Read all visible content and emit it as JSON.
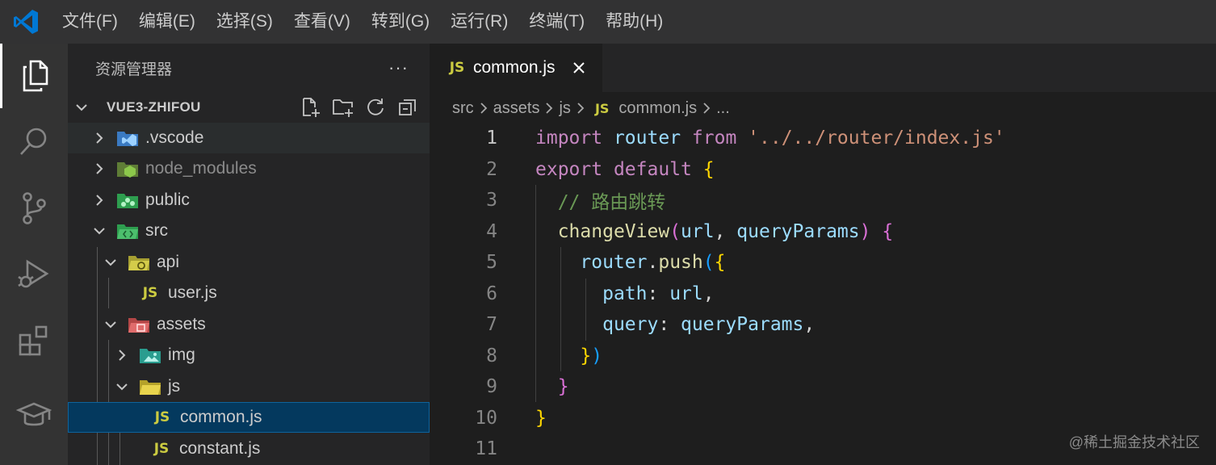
{
  "menu": [
    "文件(F)",
    "编辑(E)",
    "选择(S)",
    "查看(V)",
    "转到(G)",
    "运行(R)",
    "终端(T)",
    "帮助(H)"
  ],
  "sidebar": {
    "title": "资源管理器",
    "more": "···",
    "project": "VUE3-ZHIFOU",
    "tree": [
      {
        "label": ".vscode",
        "expanded": false,
        "icon": "vscode-folder-icon",
        "depth": 0
      },
      {
        "label": "node_modules",
        "expanded": false,
        "icon": "node-folder-icon",
        "depth": 0
      },
      {
        "label": "public",
        "expanded": false,
        "icon": "public-folder-icon",
        "depth": 0
      },
      {
        "label": "src",
        "expanded": true,
        "icon": "src-folder-icon",
        "depth": 0
      },
      {
        "label": "api",
        "expanded": true,
        "icon": "api-folder-icon",
        "depth": 1
      },
      {
        "label": "user.js",
        "icon": "js-file-icon",
        "depth": 2
      },
      {
        "label": "assets",
        "expanded": true,
        "icon": "assets-folder-icon",
        "depth": 1
      },
      {
        "label": "img",
        "expanded": false,
        "icon": "img-folder-icon",
        "depth": 2
      },
      {
        "label": "js",
        "expanded": true,
        "icon": "js-folder-icon",
        "depth": 2
      },
      {
        "label": "common.js",
        "icon": "js-file-icon",
        "depth": 3,
        "selected": true
      },
      {
        "label": "constant.js",
        "icon": "js-file-icon",
        "depth": 3
      }
    ]
  },
  "editor": {
    "tab_label": "common.js",
    "js_badge": "JS",
    "breadcrumb": [
      "src",
      "assets",
      "js",
      "common.js",
      "..."
    ],
    "line_numbers": [
      "1",
      "2",
      "3",
      "4",
      "5",
      "6",
      "7",
      "8",
      "9",
      "10",
      "11"
    ]
  },
  "watermark": "@稀土掘金技术社区",
  "colors": {
    "accent": "#0e639c",
    "selection": "#04395e",
    "js": "#cbcb41"
  }
}
